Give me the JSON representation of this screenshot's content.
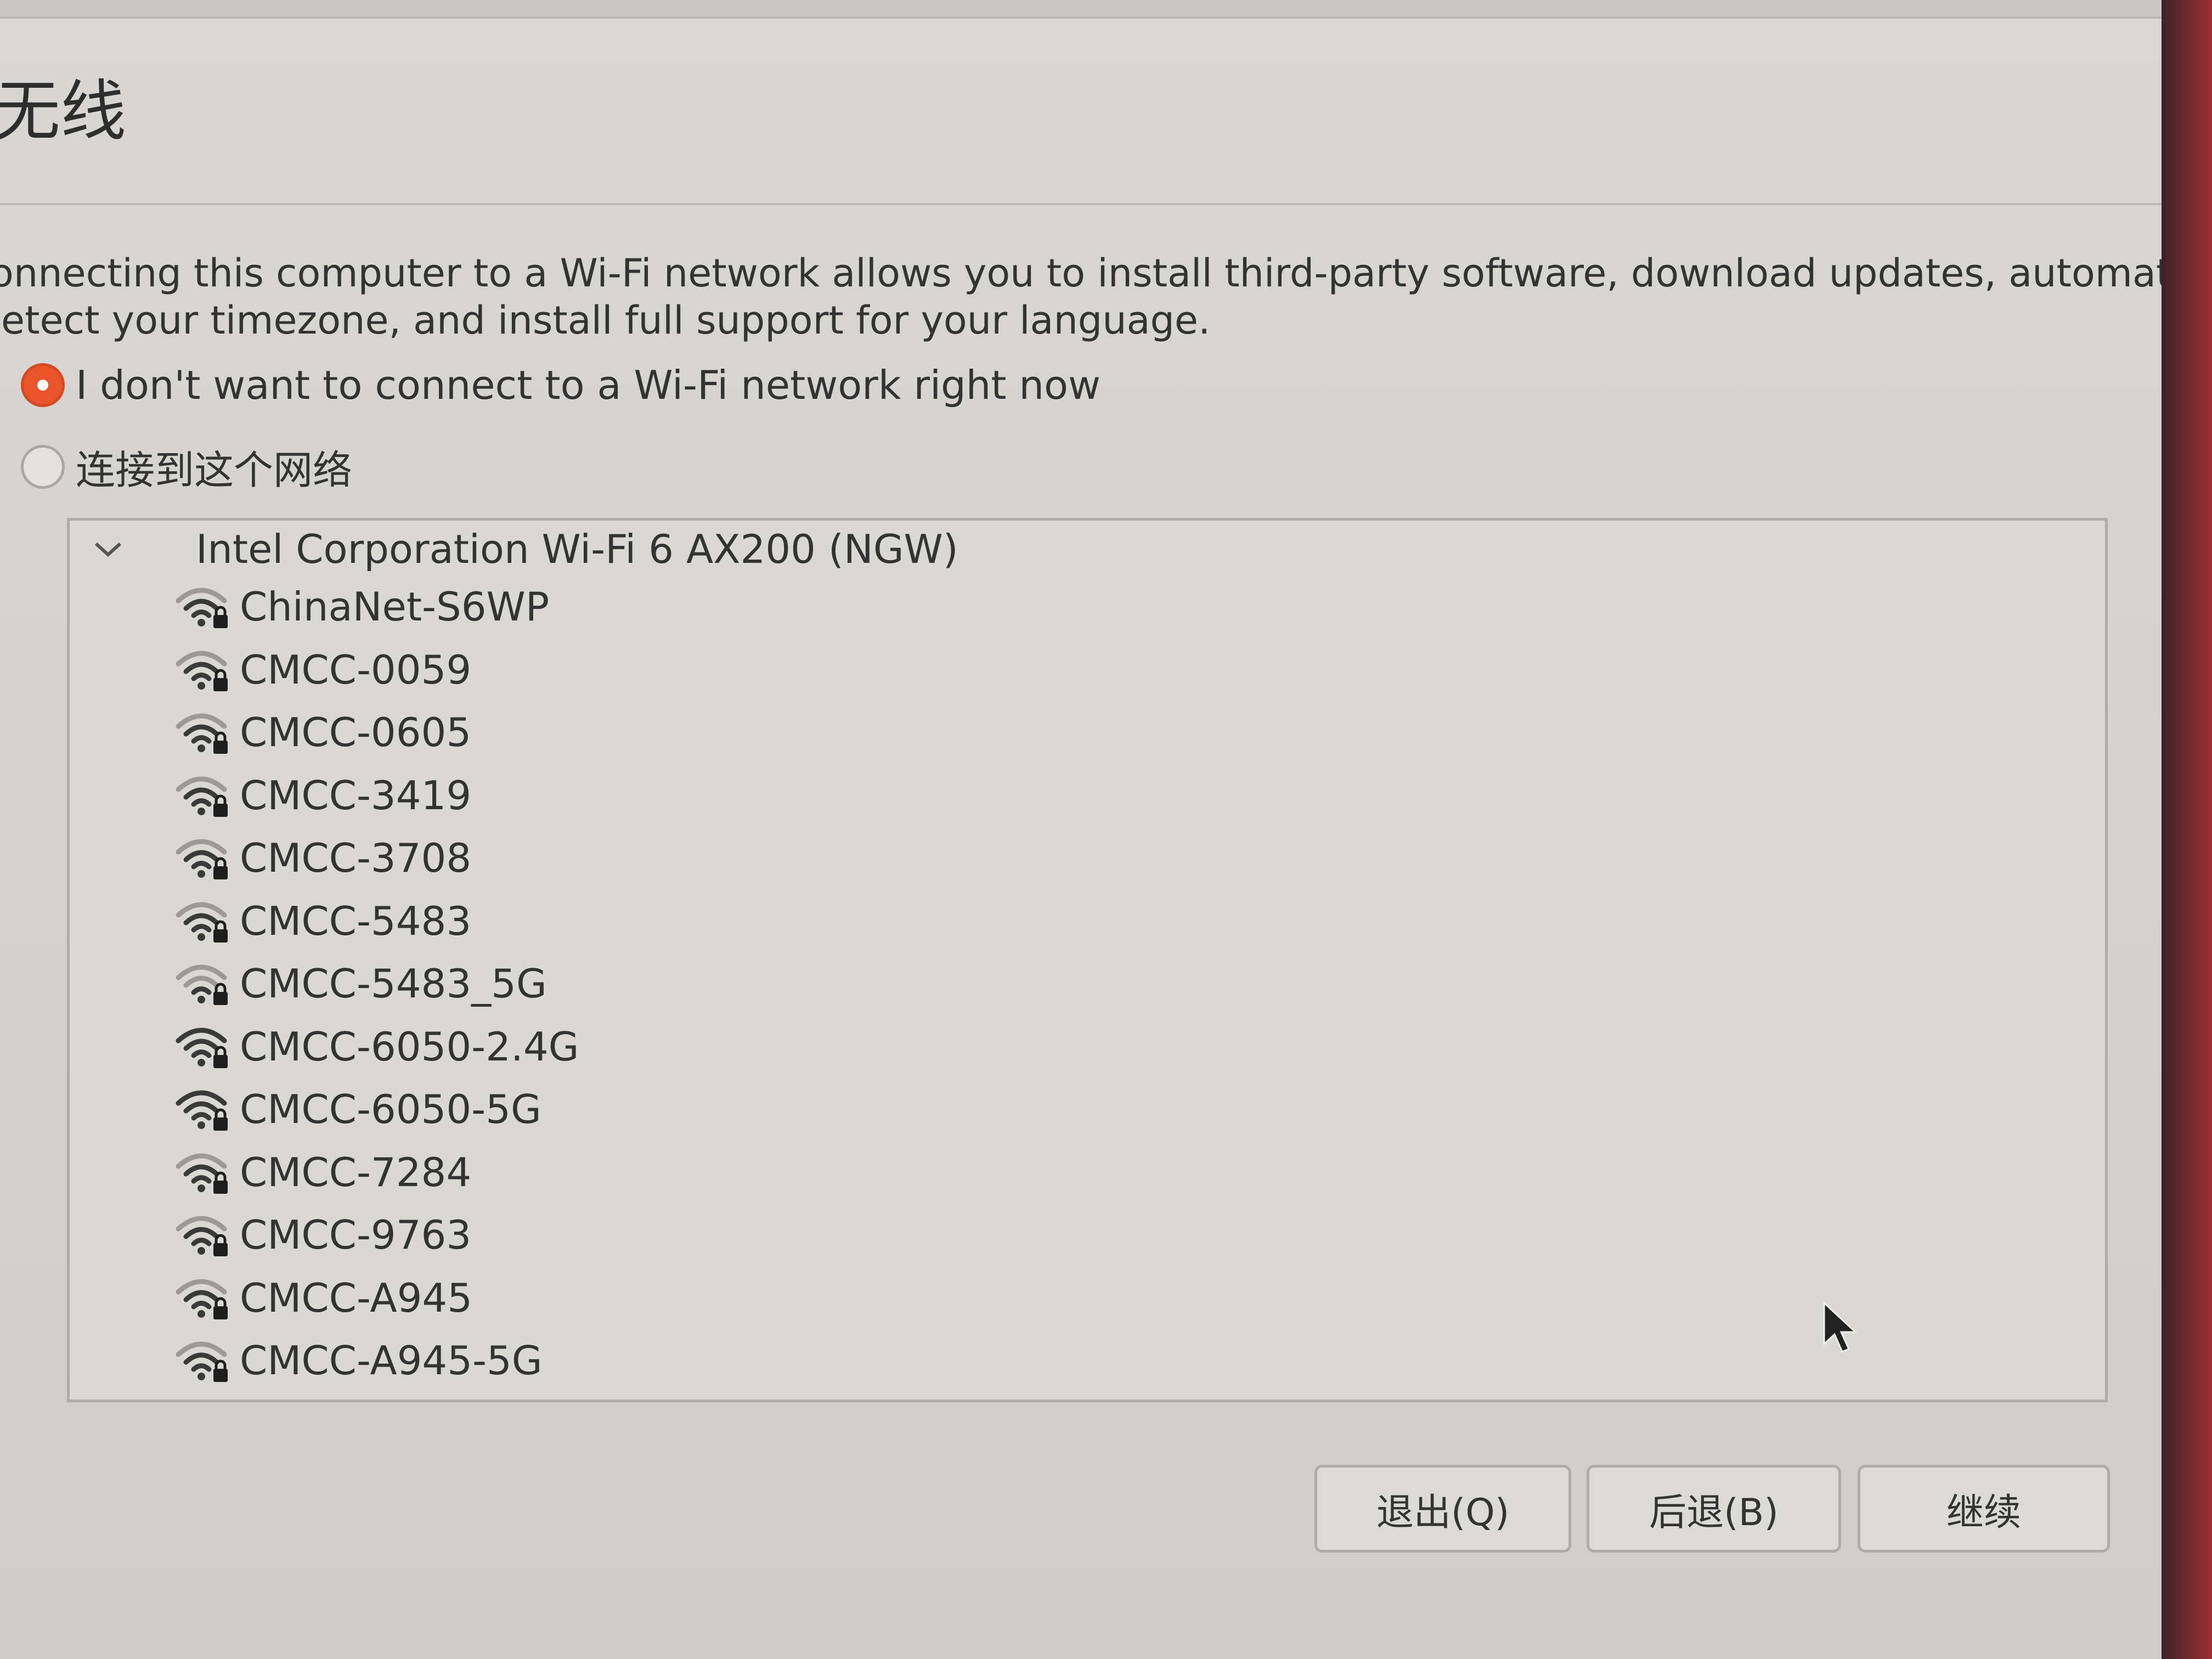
{
  "page": {
    "title": "无线",
    "description_line1": "onnecting this computer to a Wi-Fi network allows you to install third-party software, download updates, automatically",
    "description_line2": "etect your timezone, and install full support for your language."
  },
  "options": {
    "no_connect": {
      "label": "I don't want to connect to a Wi-Fi network right now",
      "selected": true
    },
    "connect": {
      "label": "连接到这个网络",
      "selected": false
    }
  },
  "network_list": {
    "adapter": "Intel Corporation Wi-Fi 6 AX200 (NGW)",
    "expanded": true,
    "networks": [
      {
        "name": "ChinaNet-S6WP",
        "signal": "medium",
        "secured": true
      },
      {
        "name": "CMCC-0059",
        "signal": "medium",
        "secured": true
      },
      {
        "name": "CMCC-0605",
        "signal": "medium",
        "secured": true
      },
      {
        "name": "CMCC-3419",
        "signal": "medium",
        "secured": true
      },
      {
        "name": "CMCC-3708",
        "signal": "medium",
        "secured": true
      },
      {
        "name": "CMCC-5483",
        "signal": "medium",
        "secured": true
      },
      {
        "name": "CMCC-5483_5G",
        "signal": "weak",
        "secured": true
      },
      {
        "name": "CMCC-6050-2.4G",
        "signal": "strong",
        "secured": true
      },
      {
        "name": "CMCC-6050-5G",
        "signal": "strong",
        "secured": true
      },
      {
        "name": "CMCC-7284",
        "signal": "medium",
        "secured": true
      },
      {
        "name": "CMCC-9763",
        "signal": "medium",
        "secured": true
      },
      {
        "name": "CMCC-A945",
        "signal": "medium",
        "secured": true
      },
      {
        "name": "CMCC-A945-5G",
        "signal": "medium",
        "secured": true
      }
    ]
  },
  "buttons": {
    "quit": "退出(Q)",
    "back": "后退(B)",
    "continue": "继续"
  },
  "colors": {
    "accent": "#e9542a",
    "window_bg": "#d6d3d0",
    "desktop_edge": "#7a2a2e"
  },
  "icons": {
    "wifi": "wifi-secured-icon",
    "expander": "chevron-down-icon",
    "cursor": "mouse-pointer-icon"
  }
}
